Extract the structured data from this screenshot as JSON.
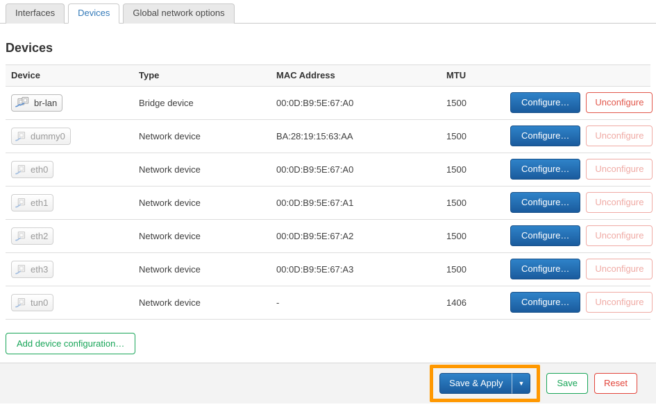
{
  "tabs": [
    {
      "label": "Interfaces",
      "active": false
    },
    {
      "label": "Devices",
      "active": true
    },
    {
      "label": "Global network options",
      "active": false
    }
  ],
  "page": {
    "title": "Devices"
  },
  "table": {
    "headers": {
      "device": "Device",
      "type": "Type",
      "mac": "MAC Address",
      "mtu": "MTU"
    },
    "rows": [
      {
        "device": "br-lan",
        "type": "Bridge device",
        "mac": "00:0D:B9:5E:67:A0",
        "mtu": "1500",
        "configure": "Configure…",
        "unconfigure": "Unconfigure",
        "state": "up",
        "icon": "bridge-icon"
      },
      {
        "device": "dummy0",
        "type": "Network device",
        "mac": "BA:28:19:15:63:AA",
        "mtu": "1500",
        "configure": "Configure…",
        "unconfigure": "Unconfigure",
        "state": "down",
        "icon": "ethernet-port-icon"
      },
      {
        "device": "eth0",
        "type": "Network device",
        "mac": "00:0D:B9:5E:67:A0",
        "mtu": "1500",
        "configure": "Configure…",
        "unconfigure": "Unconfigure",
        "state": "down",
        "icon": "ethernet-port-icon"
      },
      {
        "device": "eth1",
        "type": "Network device",
        "mac": "00:0D:B9:5E:67:A1",
        "mtu": "1500",
        "configure": "Configure…",
        "unconfigure": "Unconfigure",
        "state": "down",
        "icon": "ethernet-port-icon"
      },
      {
        "device": "eth2",
        "type": "Network device",
        "mac": "00:0D:B9:5E:67:A2",
        "mtu": "1500",
        "configure": "Configure…",
        "unconfigure": "Unconfigure",
        "state": "down",
        "icon": "ethernet-port-icon"
      },
      {
        "device": "eth3",
        "type": "Network device",
        "mac": "00:0D:B9:5E:67:A3",
        "mtu": "1500",
        "configure": "Configure…",
        "unconfigure": "Unconfigure",
        "state": "down",
        "icon": "ethernet-port-icon"
      },
      {
        "device": "tun0",
        "type": "Network device",
        "mac": "-",
        "mtu": "1406",
        "configure": "Configure…",
        "unconfigure": "Unconfigure",
        "state": "down",
        "icon": "ethernet-port-icon"
      }
    ]
  },
  "actions": {
    "add_device": "Add device configuration…"
  },
  "footer": {
    "save_apply": "Save & Apply",
    "dropdown_glyph": "▼",
    "save": "Save",
    "reset": "Reset"
  },
  "colors": {
    "accent_blue": "#3279b8",
    "button_blue": "#1a5b9d",
    "green": "#18a558",
    "red": "#e2574b",
    "highlight_orange": "#ff9800"
  }
}
